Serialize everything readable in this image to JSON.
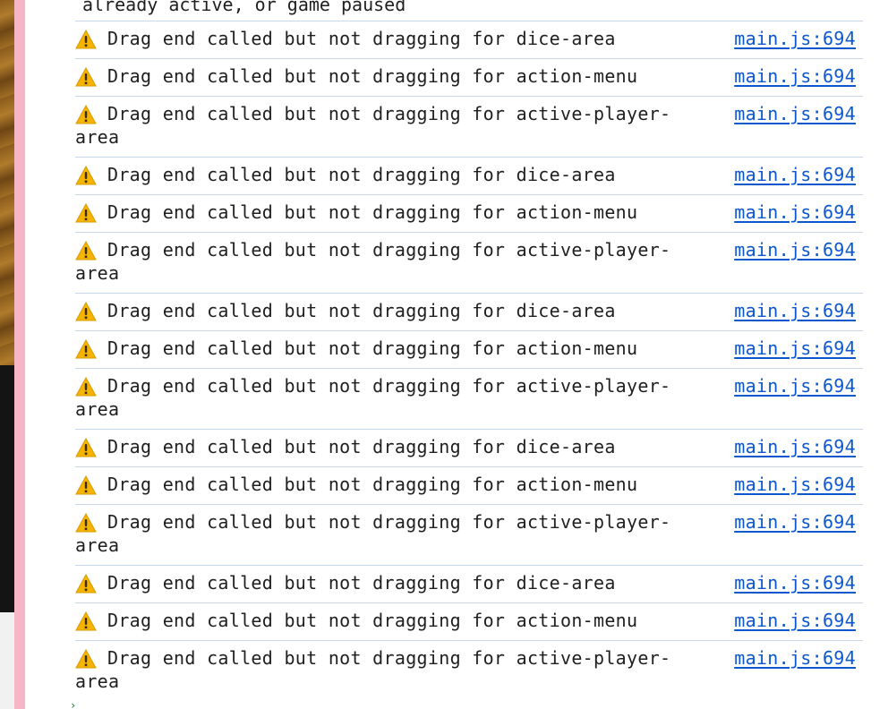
{
  "console": {
    "top_fragment": "already active, or game paused",
    "messages": [
      {
        "level": "warning",
        "icon": "warning-icon",
        "text": "Drag end called but not dragging for dice-area",
        "source": "main.js:694"
      },
      {
        "level": "warning",
        "icon": "warning-icon",
        "text": "Drag end called but not dragging for action-menu",
        "source": "main.js:694"
      },
      {
        "level": "warning",
        "icon": "warning-icon",
        "text": "Drag end called but not dragging for active-player-area",
        "source": "main.js:694"
      },
      {
        "level": "warning",
        "icon": "warning-icon",
        "text": "Drag end called but not dragging for dice-area",
        "source": "main.js:694"
      },
      {
        "level": "warning",
        "icon": "warning-icon",
        "text": "Drag end called but not dragging for action-menu",
        "source": "main.js:694"
      },
      {
        "level": "warning",
        "icon": "warning-icon",
        "text": "Drag end called but not dragging for active-player-area",
        "source": "main.js:694"
      },
      {
        "level": "warning",
        "icon": "warning-icon",
        "text": "Drag end called but not dragging for dice-area",
        "source": "main.js:694"
      },
      {
        "level": "warning",
        "icon": "warning-icon",
        "text": "Drag end called but not dragging for action-menu",
        "source": "main.js:694"
      },
      {
        "level": "warning",
        "icon": "warning-icon",
        "text": "Drag end called but not dragging for active-player-area",
        "source": "main.js:694"
      },
      {
        "level": "warning",
        "icon": "warning-icon",
        "text": "Drag end called but not dragging for dice-area",
        "source": "main.js:694"
      },
      {
        "level": "warning",
        "icon": "warning-icon",
        "text": "Drag end called but not dragging for action-menu",
        "source": "main.js:694"
      },
      {
        "level": "warning",
        "icon": "warning-icon",
        "text": "Drag end called but not dragging for active-player-area",
        "source": "main.js:694"
      },
      {
        "level": "warning",
        "icon": "warning-icon",
        "text": "Drag end called but not dragging for dice-area",
        "source": "main.js:694"
      },
      {
        "level": "warning",
        "icon": "warning-icon",
        "text": "Drag end called but not dragging for action-menu",
        "source": "main.js:694"
      },
      {
        "level": "warning",
        "icon": "warning-icon",
        "text": "Drag end called but not dragging for active-player-area",
        "source": "main.js:694"
      }
    ]
  },
  "colors": {
    "warning_icon": "#f4b400",
    "link": "#0b57d0",
    "row_divider": "#c9d7ec",
    "panel_border": "#f6b6c7"
  }
}
